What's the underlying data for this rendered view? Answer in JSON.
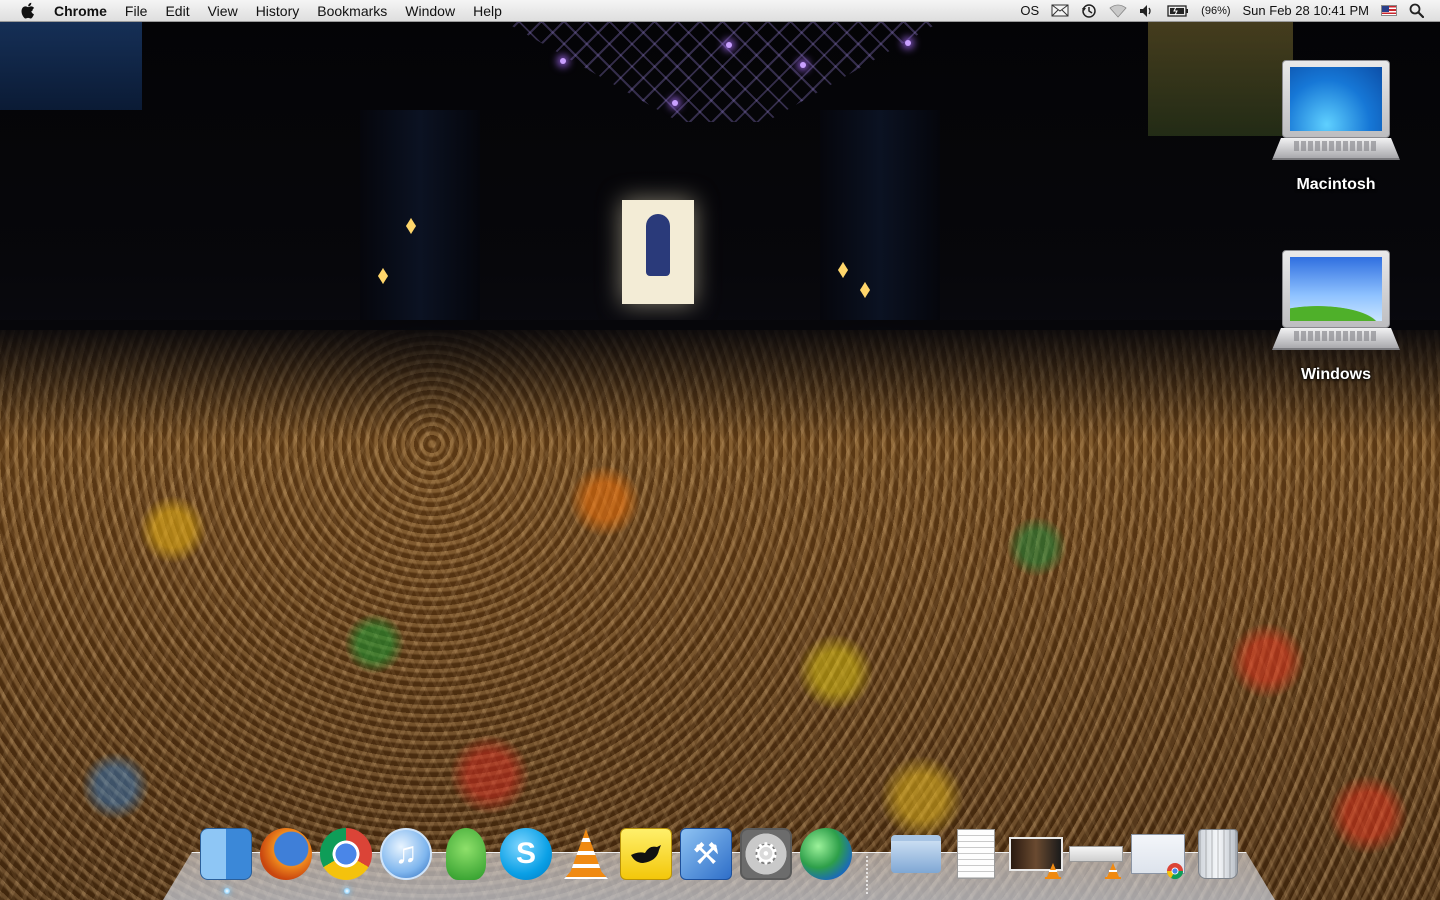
{
  "menubar": {
    "app_name": "Chrome",
    "items": [
      "File",
      "Edit",
      "View",
      "History",
      "Bookmarks",
      "Window",
      "Help"
    ],
    "status": {
      "battery_percent": "(96%)",
      "datetime": "Sun Feb 28  10:41 PM",
      "os_label": "OS"
    }
  },
  "desktop": {
    "icons": [
      {
        "label": "Macintosh",
        "icon": "mac-laptop-icon"
      },
      {
        "label": "Windows",
        "icon": "windows-laptop-icon"
      }
    ]
  },
  "dock": {
    "apps": [
      {
        "name": "Finder",
        "icon": "finder-icon",
        "running": true
      },
      {
        "name": "Firefox",
        "icon": "firefox-icon",
        "running": false
      },
      {
        "name": "Google Chrome",
        "icon": "chrome-icon",
        "running": true
      },
      {
        "name": "iTunes",
        "icon": "itunes-icon",
        "running": false
      },
      {
        "name": "Adium",
        "icon": "adium-icon",
        "running": false
      },
      {
        "name": "Skype",
        "icon": "skype-icon",
        "running": false
      },
      {
        "name": "VLC",
        "icon": "vlc-icon",
        "running": false
      },
      {
        "name": "Twitter client",
        "icon": "twitter-bird-icon",
        "running": false
      },
      {
        "name": "Xcode",
        "icon": "xcode-icon",
        "running": false
      },
      {
        "name": "System Preferences",
        "icon": "system-preferences-icon",
        "running": false
      },
      {
        "name": "Globe app",
        "icon": "globe-icon",
        "running": false
      }
    ],
    "stacks": [
      {
        "name": "Folder",
        "icon": "folder-icon"
      },
      {
        "name": "Document",
        "icon": "document-icon"
      },
      {
        "name": "Minimized VLC video",
        "icon": "minimized-vlc-video-icon"
      },
      {
        "name": "Minimized VLC controller",
        "icon": "minimized-vlc-controller-icon"
      },
      {
        "name": "Minimized Chrome window",
        "icon": "minimized-chrome-window-icon"
      },
      {
        "name": "Trash",
        "icon": "trash-icon"
      }
    ]
  },
  "colors": {
    "menubar": "#e8e8e8",
    "dock_indicator": "#9ad8ff",
    "desktop_label": "#ffffff"
  }
}
